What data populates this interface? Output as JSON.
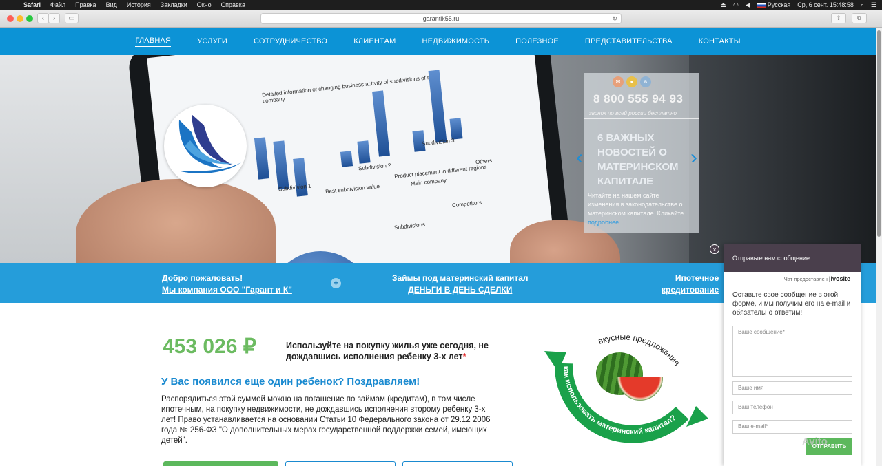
{
  "menubar": {
    "apple": "",
    "app": "Safari",
    "items": [
      "Файл",
      "Правка",
      "Вид",
      "История",
      "Закладки",
      "Окно",
      "Справка"
    ],
    "input_lang": "Русская",
    "datetime": "Ср, 6 сент.  15:48:58"
  },
  "browser": {
    "url": "garantik55.ru"
  },
  "nav": {
    "items": [
      "ГЛАВНАЯ",
      "УСЛУГИ",
      "СОТРУДНИЧЕСТВО",
      "КЛИЕНТАМ",
      "НЕДВИЖИМОСТЬ",
      "ПОЛЕЗНОЕ",
      "ПРЕДСТАВИТЕЛЬСТВА",
      "КОНТАКТЫ"
    ],
    "active": "ГЛАВНАЯ"
  },
  "hero": {
    "chart_caption": "Detailed information of changing business activity of subdivisions of main company",
    "sub1": "Subdivision 1",
    "sub2": "Subdivision 2",
    "sub3": "Subdivision 3",
    "best": "Best subdivision value",
    "product": "Product placement in different regions",
    "main_company": "Main company",
    "competitors": "Competitors",
    "others": "Others",
    "subdivisions": "Subdivisions"
  },
  "slider": {
    "phone": "8 800 555 94 93",
    "phone_sub": "звонок по всей россии бесплатно",
    "headline": "6 ВАЖНЫХ НОВОСТЕЙ О МАТЕРИНСКОМ КАПИТАЛЕ",
    "body_prefix": "Читайте на нашем сайте изменения в законодательстве о материнском капитале. Кликайте ",
    "body_link": "подробнее"
  },
  "strip": {
    "welcome_l1": "Добро пожаловать!",
    "welcome_l2": "Мы компания ООО \"Гарант и К\"",
    "loans_l1": "Займы под материнский капитал",
    "loans_l2": "ДЕНЬГИ В ДЕНЬ СДЕЛКИ",
    "mortgage_l1": "Ипотечное",
    "mortgage_l2": "кредитование",
    "plus": "+"
  },
  "content": {
    "amount": "453 026 ₽",
    "tagline": "Используйте на покупку жилья уже сегодня, не дождавшись исполнения ребенку 3-х лет",
    "tagline_star": "*",
    "congrats": "У Вас появился еще один ребенок? Поздравляем!",
    "paragraph": "Распорядиться этой суммой можно на погашение по займам (кредитам), в том числе ипотечным, на покупку недвижимости, не дождавшись исполнения второму ребенку 3-х лет! Право устанавливается на основании Статьи 10 Федерального закона от 29.12 2006 года № 256-ФЗ \"О дополнительных мерах государственной поддержки семей, имеющих детей\"."
  },
  "promo": {
    "top_text": "вкусные предложения",
    "ribbon_text": "как использовать материнский капитал?"
  },
  "chat": {
    "close": "×",
    "header": "Отправьте нам сообщение",
    "powered_by": "Чат предоставлен",
    "brand": "jivosite",
    "intro": "Оставьте свое сообщение в этой форме, и мы получим его на e-mail и обязательно ответим!",
    "message_placeholder": "Ваше сообщение*",
    "name_placeholder": "Ваше имя",
    "phone_placeholder": "Ваш телефон",
    "email_placeholder": "Ваш e-mail*",
    "send": "ОТПРАВИТЬ"
  },
  "watermark": "Avito",
  "colors": {
    "nav_blue": "#0c93d6",
    "amount_green": "#6cbb61",
    "chat_header": "#4a3f4c",
    "send_green": "#5cb85c"
  }
}
